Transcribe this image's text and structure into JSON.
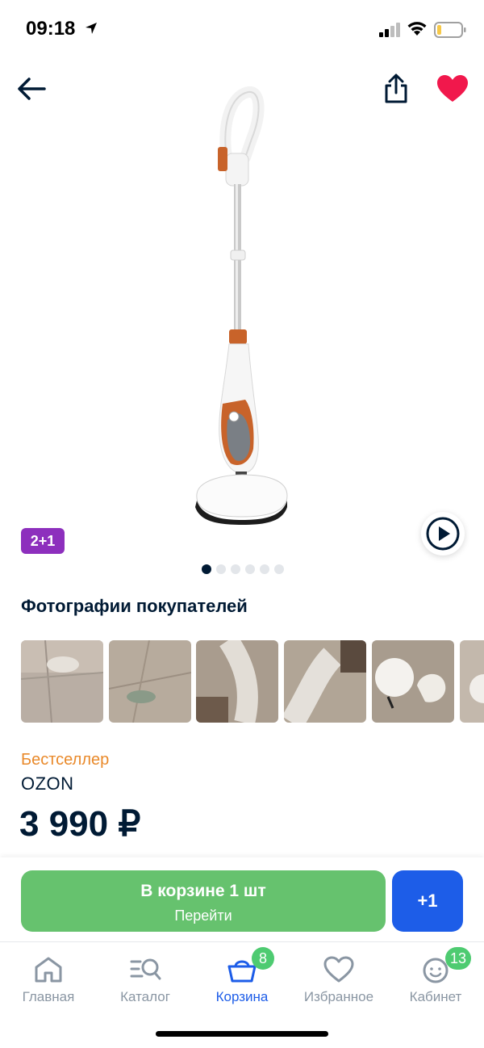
{
  "status_bar": {
    "time": "09:18"
  },
  "product": {
    "promo_badge": "2+1",
    "image_count": 6,
    "active_image_index": 0,
    "customer_photos_title": "Фотографии покупателей",
    "bestseller_label": "Бестселлер",
    "seller": "OZON",
    "price": "3 990 ₽"
  },
  "cart": {
    "in_cart_title": "В корзине 1 шт",
    "in_cart_subtitle": "Перейти",
    "plus_label": "+1"
  },
  "tabbar": {
    "items": [
      {
        "label": "Главная",
        "icon": "home-icon"
      },
      {
        "label": "Каталог",
        "icon": "catalog-search-icon"
      },
      {
        "label": "Корзина",
        "icon": "basket-icon",
        "badge": "8",
        "active": true
      },
      {
        "label": "Избранное",
        "icon": "heart-outline-icon"
      },
      {
        "label": "Кабинет",
        "icon": "profile-face-icon",
        "badge": "13"
      }
    ]
  },
  "colors": {
    "accent_blue": "#1d5de8",
    "cart_green": "#66c26e",
    "badge_green": "#4ecb71",
    "promo_purple": "#8d2fbd",
    "bestseller_orange": "#e9892a",
    "favorite_red": "#f1184c",
    "text_dark": "#001a34"
  }
}
